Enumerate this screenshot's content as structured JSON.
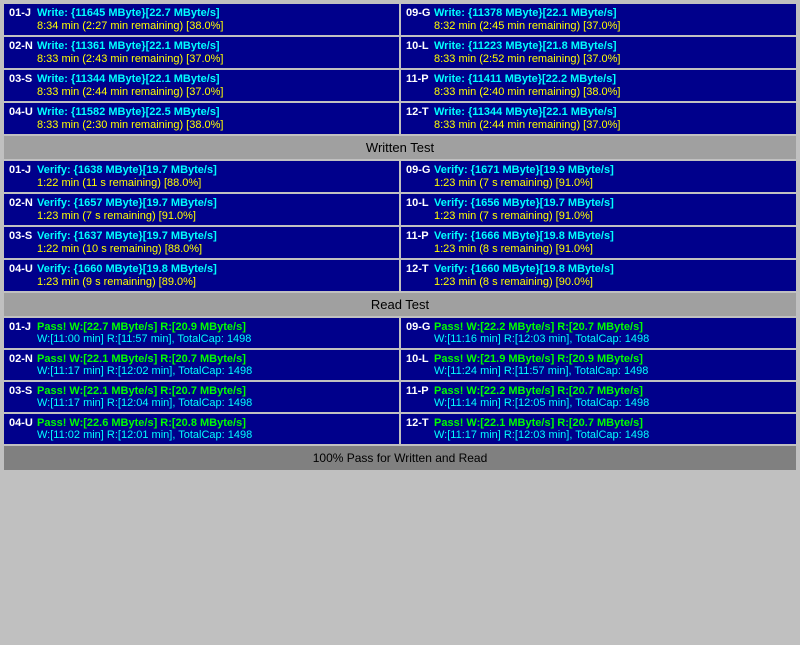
{
  "sections": {
    "written_test": {
      "label": "Written Test",
      "rows": [
        {
          "left": {
            "id": "01-J",
            "line1": "Write: {11645 MByte}[22.7 MByte/s]",
            "line2": "8:34 min (2:27 min remaining)  [38.0%]"
          },
          "right": {
            "id": "09-G",
            "line1": "Write: {11378 MByte}[22.1 MByte/s]",
            "line2": "8:32 min (2:45 min remaining)  [37.0%]"
          }
        },
        {
          "left": {
            "id": "02-N",
            "line1": "Write: {11361 MByte}[22.1 MByte/s]",
            "line2": "8:33 min (2:43 min remaining)  [37.0%]"
          },
          "right": {
            "id": "10-L",
            "line1": "Write: {11223 MByte}[21.8 MByte/s]",
            "line2": "8:33 min (2:52 min remaining)  [37.0%]"
          }
        },
        {
          "left": {
            "id": "03-S",
            "line1": "Write: {11344 MByte}[22.1 MByte/s]",
            "line2": "8:33 min (2:44 min remaining)  [37.0%]"
          },
          "right": {
            "id": "11-P",
            "line1": "Write: {11411 MByte}[22.2 MByte/s]",
            "line2": "8:33 min (2:40 min remaining)  [38.0%]"
          }
        },
        {
          "left": {
            "id": "04-U",
            "line1": "Write: {11582 MByte}[22.5 MByte/s]",
            "line2": "8:33 min (2:30 min remaining)  [38.0%]"
          },
          "right": {
            "id": "12-T",
            "line1": "Write: {11344 MByte}[22.1 MByte/s]",
            "line2": "8:33 min (2:44 min remaining)  [37.0%]"
          }
        }
      ]
    },
    "verify_test": {
      "label": "Written Test",
      "rows": [
        {
          "left": {
            "id": "01-J",
            "line1": "Verify: {1638 MByte}[19.7 MByte/s]",
            "line2": "1:22 min (11 s remaining)  [88.0%]"
          },
          "right": {
            "id": "09-G",
            "line1": "Verify: {1671 MByte}[19.9 MByte/s]",
            "line2": "1:23 min (7 s remaining)  [91.0%]"
          }
        },
        {
          "left": {
            "id": "02-N",
            "line1": "Verify: {1657 MByte}[19.7 MByte/s]",
            "line2": "1:23 min (7 s remaining)  [91.0%]"
          },
          "right": {
            "id": "10-L",
            "line1": "Verify: {1656 MByte}[19.7 MByte/s]",
            "line2": "1:23 min (7 s remaining)  [91.0%]"
          }
        },
        {
          "left": {
            "id": "03-S",
            "line1": "Verify: {1637 MByte}[19.7 MByte/s]",
            "line2": "1:22 min (10 s remaining)  [88.0%]"
          },
          "right": {
            "id": "11-P",
            "line1": "Verify: {1666 MByte}[19.8 MByte/s]",
            "line2": "1:23 min (8 s remaining)  [91.0%]"
          }
        },
        {
          "left": {
            "id": "04-U",
            "line1": "Verify: {1660 MByte}[19.8 MByte/s]",
            "line2": "1:23 min (9 s remaining)  [89.0%]"
          },
          "right": {
            "id": "12-T",
            "line1": "Verify: {1660 MByte}[19.8 MByte/s]",
            "line2": "1:23 min (8 s remaining)  [90.0%]"
          }
        }
      ]
    },
    "read_test": {
      "label": "Read Test",
      "rows": [
        {
          "left": {
            "id": "01-J",
            "line1": "Pass! W:[22.7 MByte/s] R:[20.9 MByte/s]",
            "line2": "W:[11:00 min] R:[11:57 min], TotalCap: 1498"
          },
          "right": {
            "id": "09-G",
            "line1": "Pass! W:[22.2 MByte/s] R:[20.7 MByte/s]",
            "line2": "W:[11:16 min] R:[12:03 min], TotalCap: 1498"
          }
        },
        {
          "left": {
            "id": "02-N",
            "line1": "Pass! W:[22.1 MByte/s] R:[20.7 MByte/s]",
            "line2": "W:[11:17 min] R:[12:02 min], TotalCap: 1498"
          },
          "right": {
            "id": "10-L",
            "line1": "Pass! W:[21.9 MByte/s] R:[20.9 MByte/s]",
            "line2": "W:[11:24 min] R:[11:57 min], TotalCap: 1498"
          }
        },
        {
          "left": {
            "id": "03-S",
            "line1": "Pass! W:[22.1 MByte/s] R:[20.7 MByte/s]",
            "line2": "W:[11:17 min] R:[12:04 min], TotalCap: 1498"
          },
          "right": {
            "id": "11-P",
            "line1": "Pass! W:[22.2 MByte/s] R:[20.7 MByte/s]",
            "line2": "W:[11:14 min] R:[12:05 min], TotalCap: 1498"
          }
        },
        {
          "left": {
            "id": "04-U",
            "line1": "Pass! W:[22.6 MByte/s] R:[20.8 MByte/s]",
            "line2": "W:[11:02 min] R:[12:01 min], TotalCap: 1498"
          },
          "right": {
            "id": "12-T",
            "line1": "Pass! W:[22.1 MByte/s] R:[20.7 MByte/s]",
            "line2": "W:[11:17 min] R:[12:03 min], TotalCap: 1498"
          }
        }
      ]
    }
  },
  "dividers": {
    "written": "Written Test",
    "read": "Read Test"
  },
  "footer": "100% Pass for Written and Read"
}
